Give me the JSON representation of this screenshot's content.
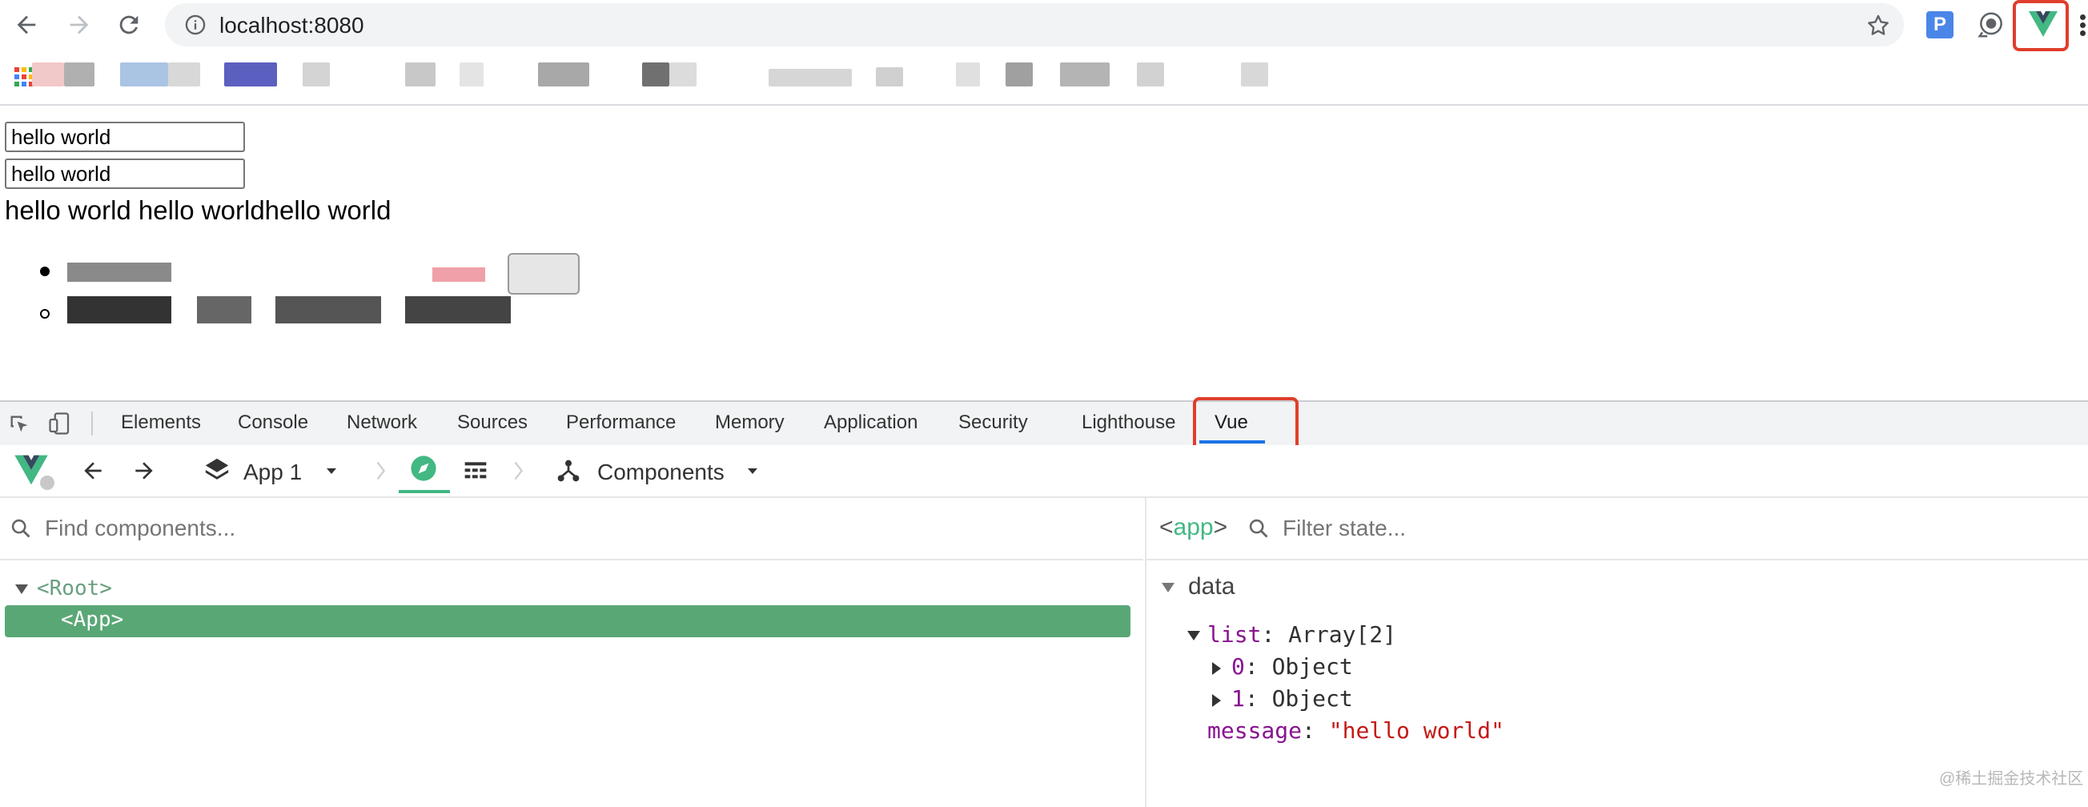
{
  "browser": {
    "url": "localhost:8080",
    "extension_badge": "P"
  },
  "page": {
    "input1_value": "hello world",
    "input2_value": "hello world",
    "text_line": "hello world hello worldhello world"
  },
  "devtools": {
    "tabs": [
      "Elements",
      "Console",
      "Network",
      "Sources",
      "Performance",
      "Memory",
      "Application",
      "Security",
      "Lighthouse",
      "Vue"
    ],
    "active_tab": "Vue"
  },
  "vue": {
    "app_select": "App 1",
    "mode_select": "Components",
    "find_placeholder": "Find components...",
    "filter_placeholder": "Filter state...",
    "selected_component": "app",
    "tree": [
      {
        "label": "<Root>",
        "expanded": true,
        "selected": false
      },
      {
        "label": "<App>",
        "expanded": false,
        "selected": true
      }
    ],
    "state": {
      "section": "data",
      "list_key": "list",
      "list_type": "Array[2]",
      "items": [
        {
          "key": "0",
          "type": "Object"
        },
        {
          "key": "1",
          "type": "Object"
        }
      ],
      "message_key": "message",
      "message_value": "\"hello world\""
    }
  },
  "watermark": "@稀土掘金技术社区",
  "colors": {
    "vue_green": "#42b883",
    "selected_row": "#5aa776",
    "highlight_box": "#e03e2d",
    "active_tab_underline": "#1a73e8"
  }
}
